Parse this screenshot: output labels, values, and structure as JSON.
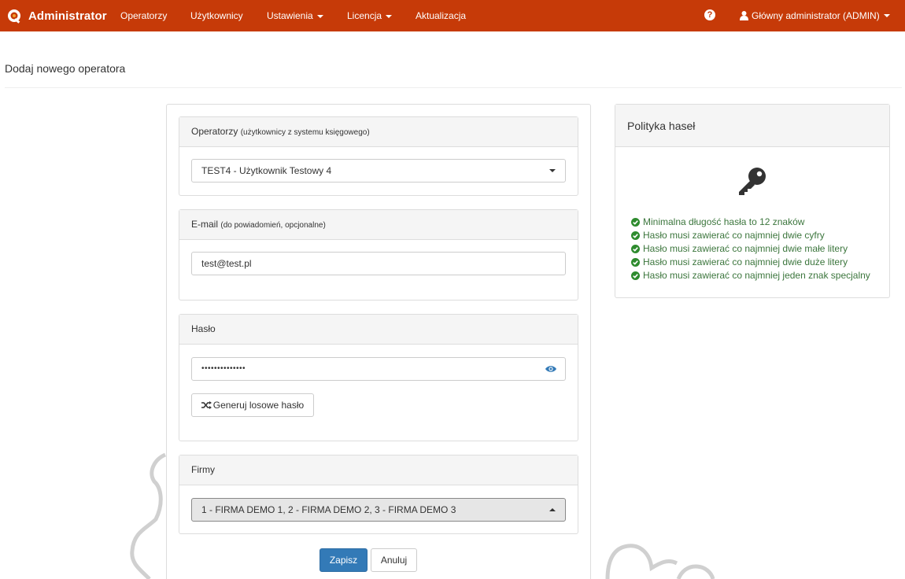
{
  "navbar": {
    "brand": "Administrator",
    "items": [
      {
        "label": "Operatorzy",
        "dropdown": false
      },
      {
        "label": "Użytkownicy",
        "dropdown": false
      },
      {
        "label": "Ustawienia",
        "dropdown": true
      },
      {
        "label": "Licencja",
        "dropdown": true
      },
      {
        "label": "Aktualizacja",
        "dropdown": false
      }
    ],
    "help_icon": "question-circle-icon",
    "help_glyph": "?",
    "user_label": "Główny administrator (ADMIN)",
    "color": "#c63a08"
  },
  "page": {
    "title": "Dodaj nowego operatora"
  },
  "form": {
    "operators": {
      "heading": "Operatorzy",
      "heading_note": "(użytkownicy z systemu księgowego)",
      "selected": "TEST4 - Użytkownik Testowy 4"
    },
    "email": {
      "heading": "E-mail",
      "heading_note": "(do powiadomień, opcjonalne)",
      "value": "test@test.pl"
    },
    "password": {
      "heading": "Hasło",
      "masked_value": "••••••••••••••",
      "generate_label": "Generuj losowe hasło"
    },
    "companies": {
      "heading": "Firmy",
      "selected": "1 - FIRMA DEMO 1, 2 - FIRMA DEMO 2, 3 - FIRMA DEMO 3"
    },
    "save_label": "Zapisz",
    "cancel_label": "Anuluj"
  },
  "policy": {
    "title": "Polityka haseł",
    "icon": "key-icon",
    "rules": [
      "Minimalna długość hasła to 12 znaków",
      "Hasło musi zawierać co najmniej dwie cyfry",
      "Hasło musi zawierać co najmniej dwie małe litery",
      "Hasło musi zawierać co najmniej dwie duże litery",
      "Hasło musi zawierać co najmniej jeden znak specjalny"
    ],
    "rule_color": "#3c763d",
    "check_color": "#2e8b2e"
  },
  "colors": {
    "primary_button": "#337ab7",
    "panel_header": "#f5f5f5"
  }
}
